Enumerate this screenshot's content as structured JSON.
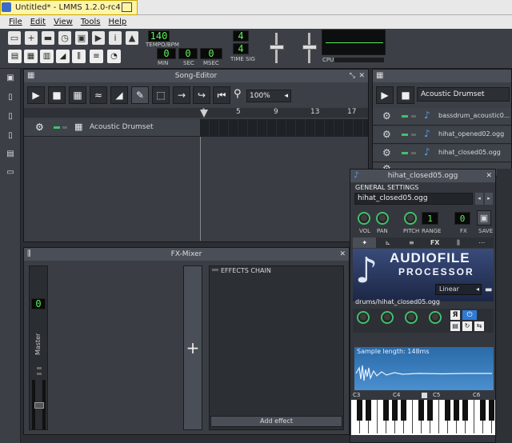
{
  "window": {
    "title": "Untitled* - LMMS 1.2.0-rc4"
  },
  "menu": [
    "File",
    "Edit",
    "View",
    "Tools",
    "Help"
  ],
  "transport": {
    "tempo": "140",
    "tempo_label": "TEMPO/BPM",
    "min": "0",
    "sec": "0",
    "msec": "0",
    "min_label": "MIN",
    "sec_label": "SEC",
    "msec_label": "MSEC",
    "timesig_num": "4",
    "timesig_den": "4",
    "timesig_label": "TIME SIG",
    "cpu_label": "CPU"
  },
  "song_editor": {
    "title": "Song-Editor",
    "zoom": "100%",
    "ruler": [
      "1",
      "5",
      "9",
      "13",
      "17"
    ],
    "track_name": "Acoustic Drumset"
  },
  "beat_editor": {
    "title": "Acoustic Drumset",
    "tracks": [
      "bassdrum_acoustic0...",
      "hihat_opened02.ogg",
      "hihat_closed05.ogg"
    ]
  },
  "fx_mixer": {
    "title": "FX-Mixer",
    "master_label": "Master",
    "master_value": "0",
    "effects_chain": "EFFECTS CHAIN",
    "add_effect": "Add effect"
  },
  "instrument": {
    "title": "hihat_closed05.ogg",
    "general_settings": "GENERAL SETTINGS",
    "name": "hihat_closed05.ogg",
    "knob_labels": [
      "VOL",
      "PAN",
      "PITCH",
      "RANGE",
      "FX",
      "SAVE"
    ],
    "range_value": "1",
    "fx_value": "0",
    "tabs": [
      "plugin",
      "env",
      "chord",
      "FX",
      "midi",
      "misc"
    ],
    "plugin_title_1": "AUDIOFILE",
    "plugin_title_2": "PROCESSOR",
    "interp": "Linear",
    "sample_path": "drums/hihat_closed05.ogg",
    "sample_length": "Sample length: 148ms",
    "piano_labels": [
      "C3",
      "C4",
      "C5",
      "C6"
    ]
  }
}
